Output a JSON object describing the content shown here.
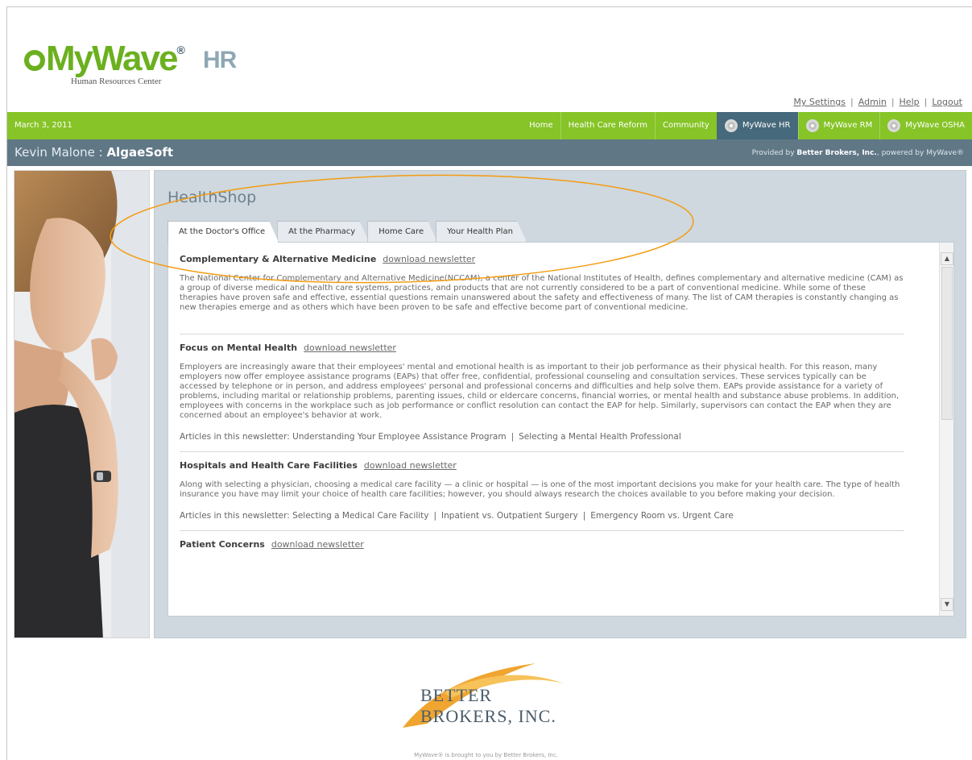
{
  "brand": {
    "logo_text": "MyWave",
    "logo_reg": "®",
    "logo_suffix": "HR",
    "logo_subtitle": "Human Resources Center"
  },
  "util_links": [
    "My Settings",
    "Admin",
    "Help",
    "Logout"
  ],
  "navbar": {
    "date": "March 3, 2011",
    "items": [
      "Home",
      "Health Care Reform",
      "Community"
    ],
    "products": [
      "MyWave HR",
      "MyWave RM",
      "MyWave OSHA"
    ],
    "active_product": "MyWave HR",
    "color": "#86c427"
  },
  "userbar": {
    "user_name": "Kevin Malone",
    "separator": " : ",
    "company": "AlgaeSoft",
    "provided_prefix": "Provided by ",
    "provider": "Better Brokers, Inc.",
    "provided_suffix": ", powered by MyWave®"
  },
  "healthshop": {
    "title": "HealthShop",
    "tabs": [
      "At the Doctor's Office",
      "At the Pharmacy",
      "Home Care",
      "Your Health Plan"
    ],
    "active_tab": "At the Doctor's Office",
    "sections": [
      {
        "title": "Complementary & Alternative Medicine",
        "link": "download newsletter",
        "body": "The National Center for Complementary and Alternative Medicine(NCCAM), a center of the National Institutes of Health, defines complementary and alternative medicine (CAM) as a group of diverse medical and health care systems, practices, and products that are not currently considered to be a part of conventional medicine. While some of these therapies have proven safe and effective, essential questions remain unanswered about the safety and effectiveness of many. The list of CAM therapies is constantly changing as new therapies emerge and as others which have been proven to be safe and effective become part of conventional medicine."
      },
      {
        "title": "Focus on Mental Health",
        "link": "download newsletter",
        "body": "Employers are increasingly aware that their employees' mental and emotional health is as important to their job performance as their physical health. For this reason, many employers now offer employee assistance programs (EAPs) that offer free, confidential, professional counseling and consultation services. These services typically can be accessed by telephone or in person, and address employees' personal and professional concerns and difficulties and help solve them. EAPs provide assistance for a variety of problems, including marital or relationship problems, parenting issues, child or eldercare concerns, financial worries, or mental health and substance abuse problems. In addition, employees with concerns in the workplace such as job performance or conflict resolution can contact the EAP for help. Similarly, supervisors can contact the EAP when they are concerned about an employee's behavior at work.",
        "articles_label": "Articles in this newsletter:",
        "articles": [
          "Understanding Your Employee Assistance Program",
          "Selecting a Mental Health Professional"
        ]
      },
      {
        "title": "Hospitals and Health Care Facilities",
        "link": "download newsletter",
        "body": "Along with selecting a physician, choosing a medical care facility — a clinic or hospital — is one of the most important decisions you make for your health care. The type of health insurance you have may limit your choice of health care facilities; however, you should always research the choices available to you before making your decision.",
        "articles_label": "Articles in this newsletter:",
        "articles": [
          "Selecting a Medical Care Facility",
          "Inpatient vs. Outpatient Surgery",
          "Emergency Room vs. Urgent Care"
        ]
      },
      {
        "title": "Patient Concerns",
        "link": "download newsletter",
        "body": ""
      }
    ]
  },
  "footer": {
    "logo_line1": "BETTER",
    "logo_line2": "BROKERS, INC.",
    "text": "MyWave® is brought to you by Better Brokers, Inc."
  },
  "icons": {
    "scroll_up": "triangle-up-icon",
    "scroll_down": "triangle-down-icon",
    "product": "mywave-circle-icon"
  },
  "colors": {
    "nav_green": "#86c427",
    "user_bar": "#607786",
    "active_product": "#46697b",
    "panel": "#cfd8df",
    "annotation": "#f39c12"
  }
}
